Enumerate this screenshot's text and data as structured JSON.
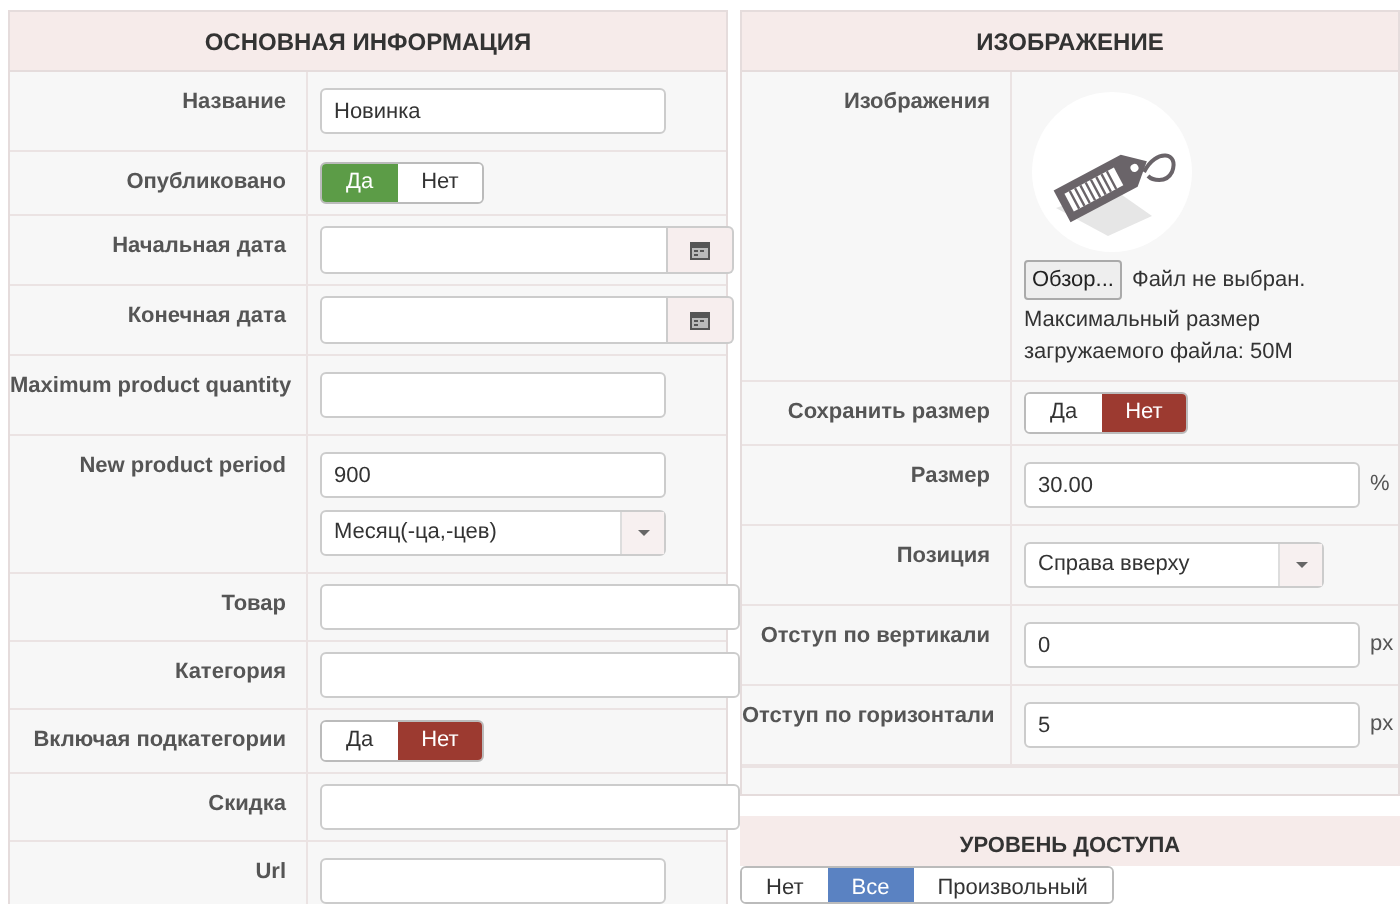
{
  "panels": [
    {
      "title": "ОСНОВНАЯ ИНФОРМАЦИЯ",
      "rows": [
        {
          "label": "Название",
          "fields": [
            {
              "kind": "text",
              "value": "Новинка"
            }
          ]
        },
        {
          "label": "Опубликовано",
          "fields": [
            {
              "kind": "toggle",
              "options": [
                {
                  "label": "Да",
                  "color": "#5c9c47",
                  "selected": true
                },
                {
                  "label": "Нет",
                  "selected": false
                }
              ]
            }
          ]
        },
        {
          "label": "Начальная дата",
          "fields": [
            {
              "kind": "date"
            }
          ]
        },
        {
          "label": "Конечная дата",
          "fields": [
            {
              "kind": "date"
            }
          ]
        },
        {
          "label": "Maximum product quantity",
          "fields": [
            {
              "kind": "text"
            }
          ]
        },
        {
          "label": "New product period",
          "fields": [
            {
              "kind": "text",
              "value": "900"
            },
            {
              "kind": "select",
              "value": "Месяц(-ца,-цев)"
            }
          ]
        },
        {
          "label": "Товар",
          "fields": [
            {
              "kind": "longtext"
            }
          ]
        },
        {
          "label": "Категория",
          "fields": [
            {
              "kind": "longtext"
            }
          ]
        },
        {
          "label": "Включая подкатегории",
          "fields": [
            {
              "kind": "toggle",
              "options": [
                {
                  "label": "Да",
                  "selected": false
                },
                {
                  "label": "Нет",
                  "color": "#9c3a30",
                  "selected": true
                }
              ]
            }
          ]
        },
        {
          "label": "Скидка",
          "fields": [
            {
              "kind": "longtext"
            }
          ]
        },
        {
          "label": "Url",
          "fields": [
            {
              "kind": "text"
            }
          ]
        }
      ]
    },
    {
      "title": "ИЗОБРАЖЕНИЕ",
      "rows": [
        {
          "label": "Изображения",
          "fields": [
            {
              "kind": "image",
              "button": "Обзор...",
              "status": "Файл не выбран.",
              "note": "Максимальный размер загружаемого файла: 50M"
            }
          ]
        },
        {
          "label": "Сохранить размер",
          "fields": [
            {
              "kind": "toggle",
              "options": [
                {
                  "label": "Да",
                  "selected": false
                },
                {
                  "label": "Нет",
                  "color": "#9c3a30",
                  "selected": true
                }
              ]
            }
          ]
        },
        {
          "label": "Размер",
          "fields": [
            {
              "kind": "text",
              "value": "30.00",
              "unit": "%"
            }
          ]
        },
        {
          "label": "Позиция",
          "fields": [
            {
              "kind": "select",
              "value": "Справа вверху"
            }
          ]
        },
        {
          "label": "Отступ по вертикали",
          "fields": [
            {
              "kind": "text",
              "value": "0",
              "unit": "px"
            }
          ]
        },
        {
          "label": "Отступ по горизонтали",
          "fields": [
            {
              "kind": "text",
              "value": "5",
              "unit": "px"
            }
          ]
        }
      ]
    }
  ],
  "access": {
    "title": "УРОВЕНЬ ДОСТУПА",
    "options": [
      {
        "label": "Нет",
        "selected": false
      },
      {
        "label": "Все",
        "color": "#5a82c2",
        "selected": true
      },
      {
        "label": "Произвольный",
        "selected": false
      }
    ]
  }
}
